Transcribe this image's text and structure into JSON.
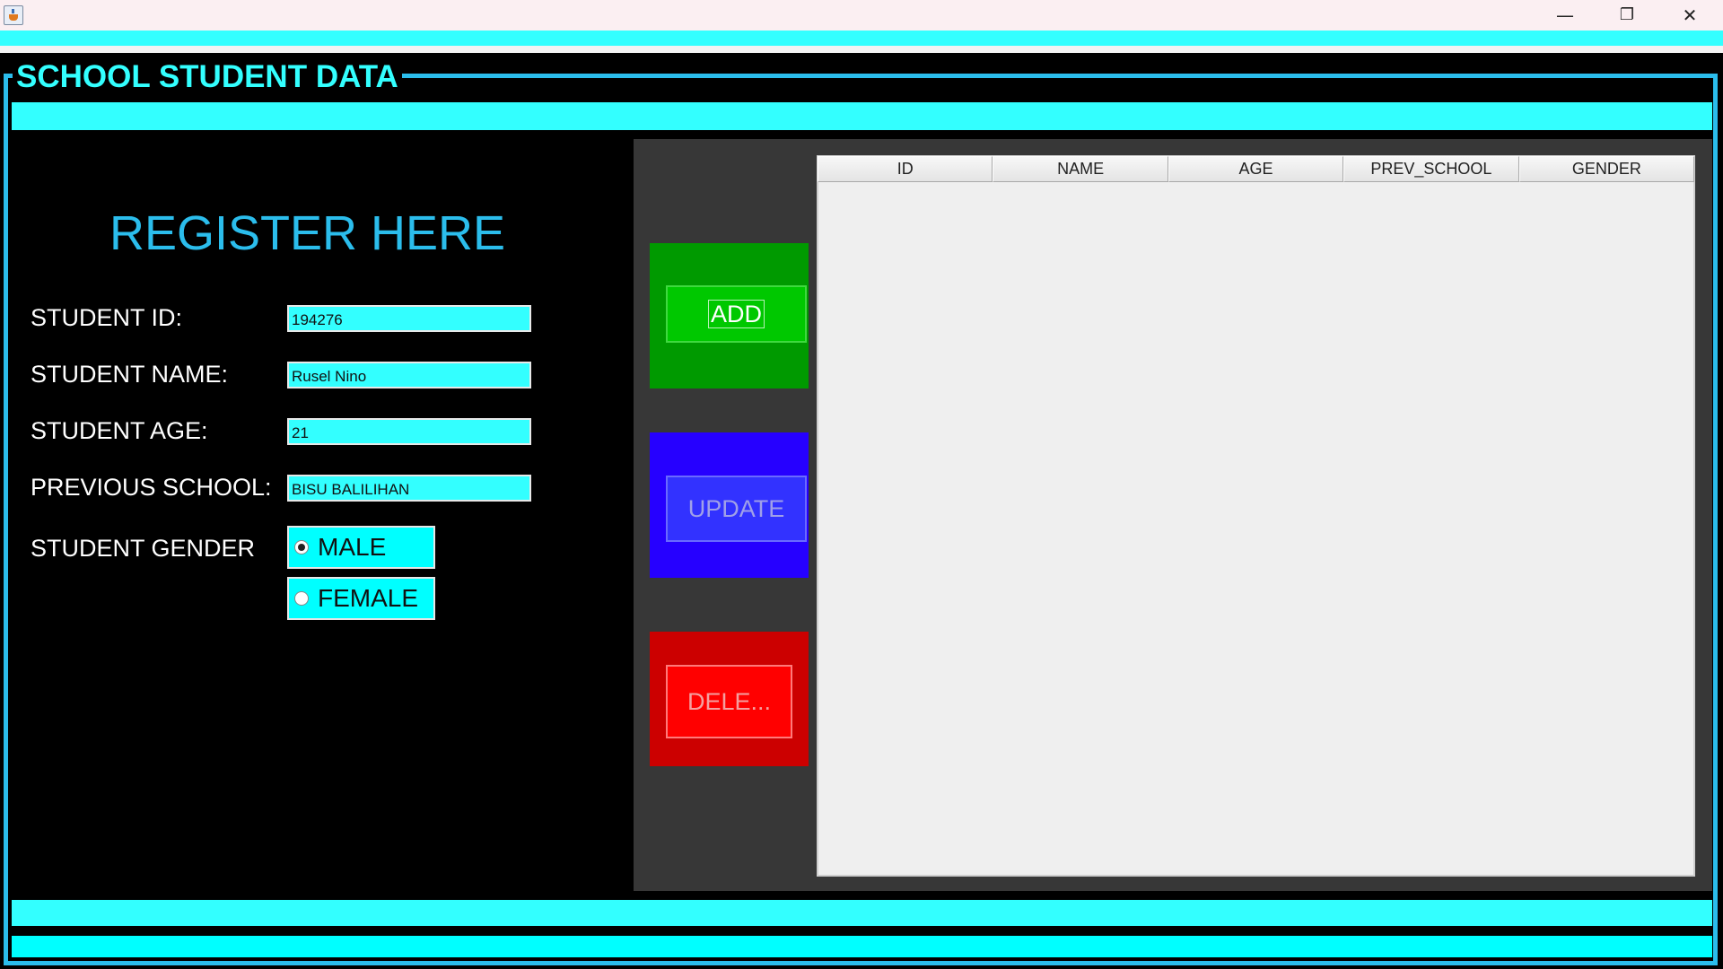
{
  "window": {
    "controls": {
      "minimize": "—",
      "restore": "❐",
      "close": "✕"
    }
  },
  "frame": {
    "title": "SCHOOL STUDENT DATA"
  },
  "form": {
    "heading": "REGISTER HERE",
    "fields": [
      {
        "label": "STUDENT ID:",
        "value": "194276"
      },
      {
        "label": "STUDENT NAME:",
        "value": "Rusel Nino"
      },
      {
        "label": "STUDENT AGE:",
        "value": "21"
      },
      {
        "label": "PREVIOUS SCHOOL:",
        "value": "BISU BALILIHAN"
      }
    ],
    "gender": {
      "label": "STUDENT GENDER",
      "options": [
        {
          "label": "MALE",
          "selected": true
        },
        {
          "label": "FEMALE",
          "selected": false
        }
      ]
    }
  },
  "actions": {
    "add": "ADD",
    "update": "UPDATE",
    "delete": "DELE..."
  },
  "table": {
    "columns": [
      "ID",
      "NAME",
      "AGE",
      "PREV_SCHOOL",
      "GENDER"
    ],
    "rows": []
  },
  "colors": {
    "accent_cyan": "#33ffff",
    "border_blue": "#2bbdec",
    "add_green": "#00c800",
    "update_blue": "#3232ff",
    "delete_red": "#ff0000"
  }
}
